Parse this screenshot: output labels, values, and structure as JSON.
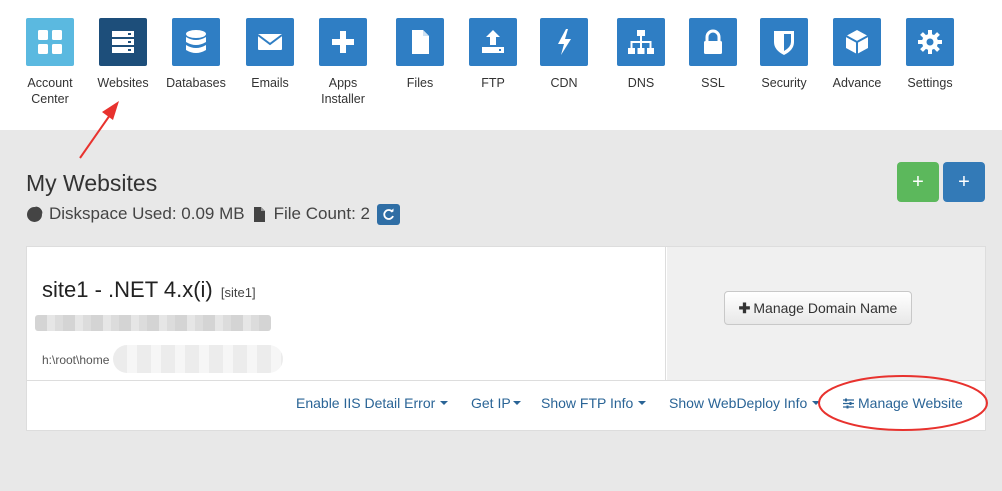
{
  "nav": [
    {
      "label": "Account\nCenter",
      "icon": "grid-icon"
    },
    {
      "label": "Websites",
      "icon": "server-icon"
    },
    {
      "label": "Databases",
      "icon": "database-icon"
    },
    {
      "label": "Emails",
      "icon": "envelope-icon"
    },
    {
      "label": "Apps\nInstaller",
      "icon": "plus-icon"
    },
    {
      "label": "Files",
      "icon": "file-icon"
    },
    {
      "label": "FTP",
      "icon": "upload-icon"
    },
    {
      "label": "CDN",
      "icon": "bolt-icon"
    },
    {
      "label": "DNS",
      "icon": "sitemap-icon"
    },
    {
      "label": "SSL",
      "icon": "lock-icon"
    },
    {
      "label": "Security",
      "icon": "shield-icon"
    },
    {
      "label": "Advance",
      "icon": "cube-icon"
    },
    {
      "label": "Settings",
      "icon": "gear-icon"
    }
  ],
  "page": {
    "title": "My Websites",
    "disk_used": "Diskspace Used: 0.09 MB",
    "file_count": "File Count: 2"
  },
  "buttons": {
    "add_green": "+",
    "add_blue": "+"
  },
  "site": {
    "title": "site1 - .NET 4.x(i)",
    "tag": "[site1]",
    "path": "h:\\root\\home",
    "manage_domain": "Manage Domain Name"
  },
  "actions": {
    "iis": "Enable IIS Detail Error",
    "ip": "Get IP",
    "ftp": "Show FTP Info",
    "webdeploy": "Show WebDeploy Info",
    "manage": "Manage Website"
  },
  "colors": {
    "primary": "#2f7ec4",
    "active": "#1d4e7a",
    "accent_light": "#5bb9e0",
    "green": "#5cb85c",
    "annotation": "#e8322e"
  }
}
